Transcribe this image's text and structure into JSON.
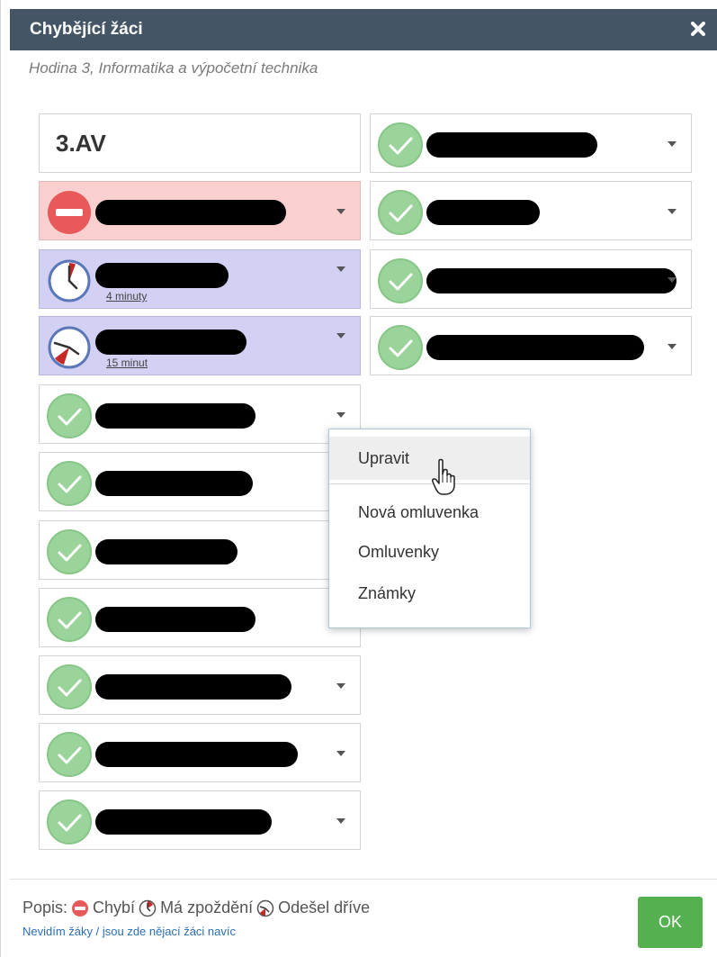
{
  "dialog": {
    "title": "Chybějící žáci",
    "subtitle": "Hodina 3, Informatika a výpočetní technika"
  },
  "class_card": {
    "name": "3.AV"
  },
  "students_left": [
    {
      "status": "absent",
      "has_caret": true
    },
    {
      "status": "late",
      "has_caret": true,
      "note": "4 minuty"
    },
    {
      "status": "left_early",
      "has_caret": true,
      "note": "15 minut"
    },
    {
      "status": "present",
      "has_caret": true
    },
    {
      "status": "present",
      "has_caret": false
    },
    {
      "status": "present",
      "has_caret": false
    },
    {
      "status": "present",
      "has_caret": false
    },
    {
      "status": "present",
      "has_caret": true
    },
    {
      "status": "present",
      "has_caret": true
    },
    {
      "status": "present",
      "has_caret": true
    }
  ],
  "students_right": [
    {
      "status": "present",
      "has_caret": true
    },
    {
      "status": "present",
      "has_caret": true
    },
    {
      "status": "present",
      "has_caret": true
    },
    {
      "status": "present",
      "has_caret": true
    }
  ],
  "context_menu": {
    "items": [
      "Upravit",
      "Nová omluvenka",
      "Omluvenky",
      "Známky"
    ],
    "hovered": "Upravit"
  },
  "legend": {
    "prefix": "Popis:",
    "absent": "Chybí",
    "late": "Má zpoždění",
    "left_early": "Odešel dříve",
    "link": "Nevidím žáky / jsou zde nějací žáci navíc"
  },
  "ok_label": "OK",
  "colors": {
    "titlebar": "#445566",
    "absent_bg": "#f9cfcf",
    "late_bg": "#d3d1f3",
    "present_icon": "#9bd49b",
    "absent_icon": "#e85a5a",
    "ok_button": "#55b150"
  }
}
